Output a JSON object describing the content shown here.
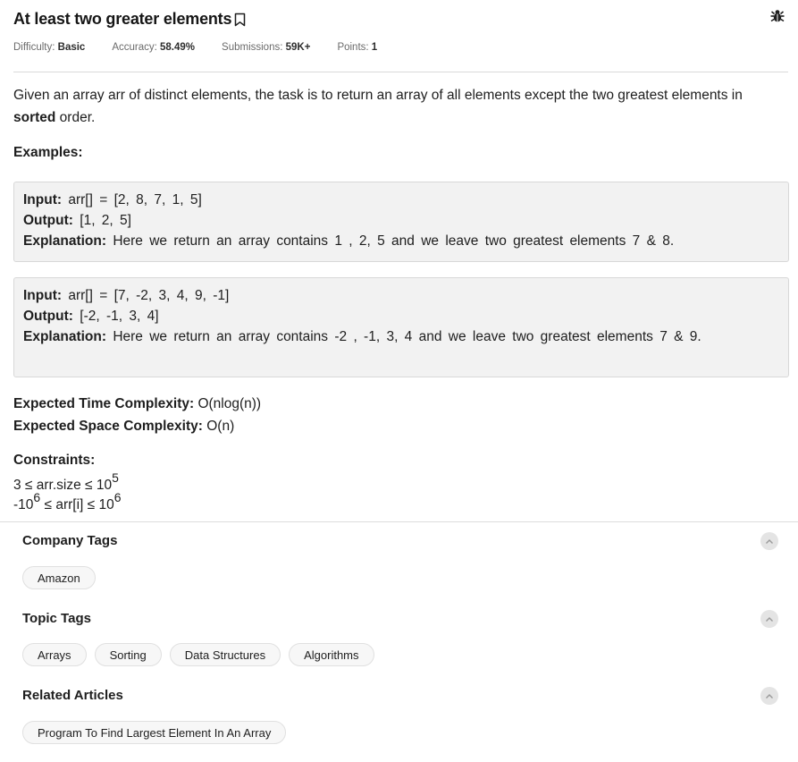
{
  "problem": {
    "title": "At least two greater elements",
    "meta": [
      {
        "label": "Difficulty: ",
        "value": "Basic"
      },
      {
        "label": "Accuracy: ",
        "value": "58.49%"
      },
      {
        "label": "Submissions: ",
        "value": "59K+"
      },
      {
        "label": "Points: ",
        "value": "1"
      }
    ],
    "description": {
      "part1": "Given an array arr of distinct elements, the task is to return an array of all elements except the two greatest elements in ",
      "bold": "sorted",
      "part2": " order."
    },
    "examples_label": "Examples:",
    "examples": [
      {
        "input_label": "Input:",
        "input": "arr[] = [2, 8, 7, 1, 5]",
        "output_label": "Output:",
        "output": "[1, 2, 5]",
        "explanation_label": "Explanation:",
        "explanation": "Here we return an array contains 1 , 2, 5 and we leave two greatest elements 7 & 8."
      },
      {
        "input_label": "Input:",
        "input": "arr[] = [7, -2, 3, 4, 9, -1]",
        "output_label": "Output:",
        "output": "[-2, -1, 3, 4]",
        "explanation_label": "Explanation:",
        "explanation": "Here we return an array contains -2 , -1, 3, 4 and we leave two greatest elements 7 & 9."
      }
    ],
    "time_label": "Expected Time Complexity:",
    "time_value": "O(nlog(n))",
    "space_label": "Expected Space Complexity:",
    "space_value": "O(n)",
    "constraints_label": "Constraints:",
    "constraints": [
      {
        "a": "3 ≤ arr.size ≤ 10",
        "a_sup": "5"
      },
      {
        "pre": "-10",
        "pre_sup": "6",
        "mid": " ≤ arr[i] ≤ 10",
        "post_sup": "6"
      }
    ]
  },
  "sections": {
    "company": {
      "title": "Company Tags",
      "tags": [
        "Amazon"
      ]
    },
    "topic": {
      "title": "Topic Tags",
      "tags": [
        "Arrays",
        "Sorting",
        "Data Structures",
        "Algorithms"
      ]
    },
    "articles": {
      "title": "Related Articles",
      "tags": [
        "Program To Find Largest Element In An Array"
      ]
    }
  },
  "icons": {
    "bookmark": "bookmark-icon",
    "bug": "bug-report-icon",
    "collapse": "chevron-up-icon"
  },
  "colors": {
    "text": "#1e1e1e",
    "muted": "#6b6b6b",
    "example_bg": "#f2f2f2",
    "tag_bg": "#f7f7f7"
  }
}
